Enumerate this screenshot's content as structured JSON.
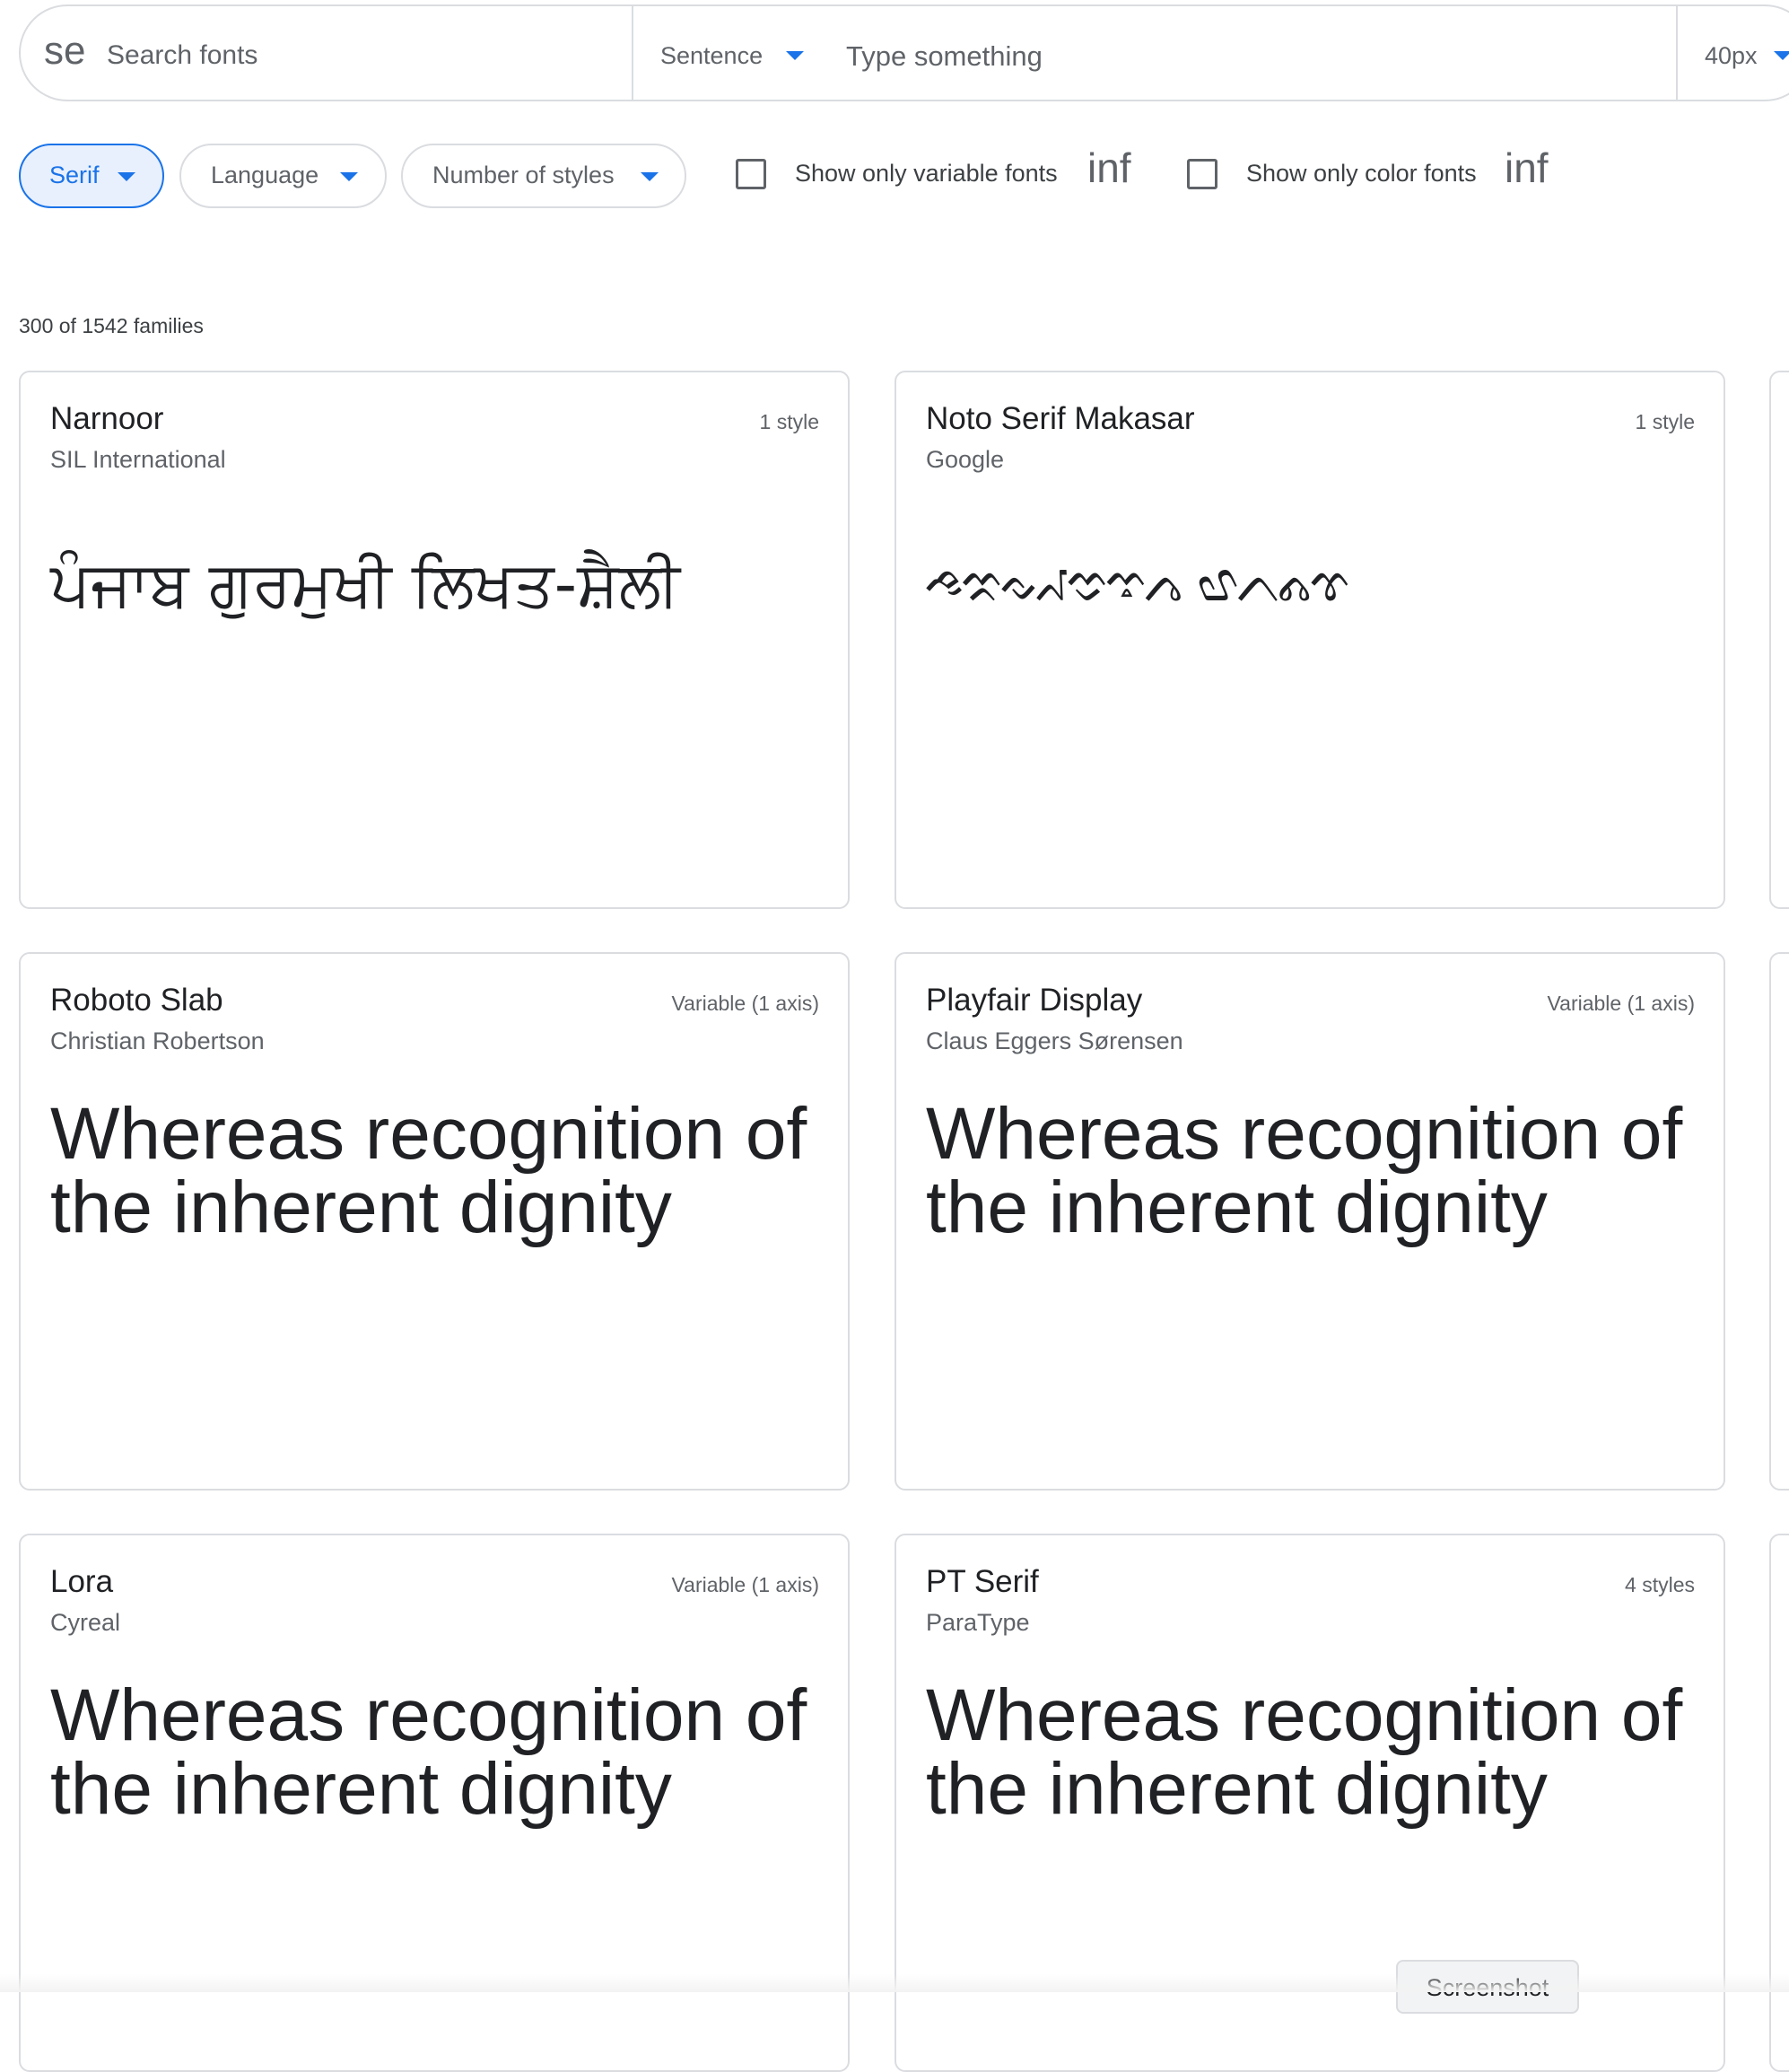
{
  "search": {
    "icon_text": "se",
    "icon_name": "search-icon",
    "placeholder": "Search fonts",
    "preview_mode": "Sentence",
    "preview_text_placeholder": "Type something",
    "font_size": "40px"
  },
  "filters": {
    "category": "Serif",
    "language": "Language",
    "styles": "Number of styles",
    "variable_label": "Show only variable fonts",
    "color_label": "Show only color fonts",
    "info_icon_text": "inf",
    "variable_checked": false,
    "color_checked": false
  },
  "results": {
    "count_text": "300 of 1542 families"
  },
  "cards": [
    {
      "name": "Narnoor",
      "author": "SIL International",
      "styles": "1 style",
      "preview": "ਪੰਜਾਬ ਗੁਰਮੁਖੀ ਲਿਖਤ-ਸ਼ੈਲੀ"
    },
    {
      "name": "Noto Serif Makasar",
      "author": "Google",
      "styles": "1 style",
      "preview": "𑻠𑻡𑻢𑻣𑻤𑻥𑻦 𑻧𑻨𑻩𑻪"
    },
    {
      "name": "Roboto Slab",
      "author": "Christian Robertson",
      "styles": "Variable (1 axis)",
      "preview": "Whereas recognition of the inherent dignity"
    },
    {
      "name": "Playfair Display",
      "author": "Claus Eggers Sørensen",
      "styles": "Variable (1 axis)",
      "preview": "Whereas recognition of the inherent dignity"
    },
    {
      "name": "Lora",
      "author": "Cyreal",
      "styles": "Variable (1 axis)",
      "preview": "Whereas recognition of the inherent dignity"
    },
    {
      "name": "PT Serif",
      "author": "ParaType",
      "styles": "4 styles",
      "preview": "Whereas recognition of the inherent dignity"
    }
  ],
  "overlay": {
    "screenshot_label": "Screenshot"
  },
  "colors": {
    "accent": "#1a73e8",
    "border": "#dadce0",
    "chip_active_bg": "#e8f0fe",
    "text_secondary": "#5f6368"
  }
}
